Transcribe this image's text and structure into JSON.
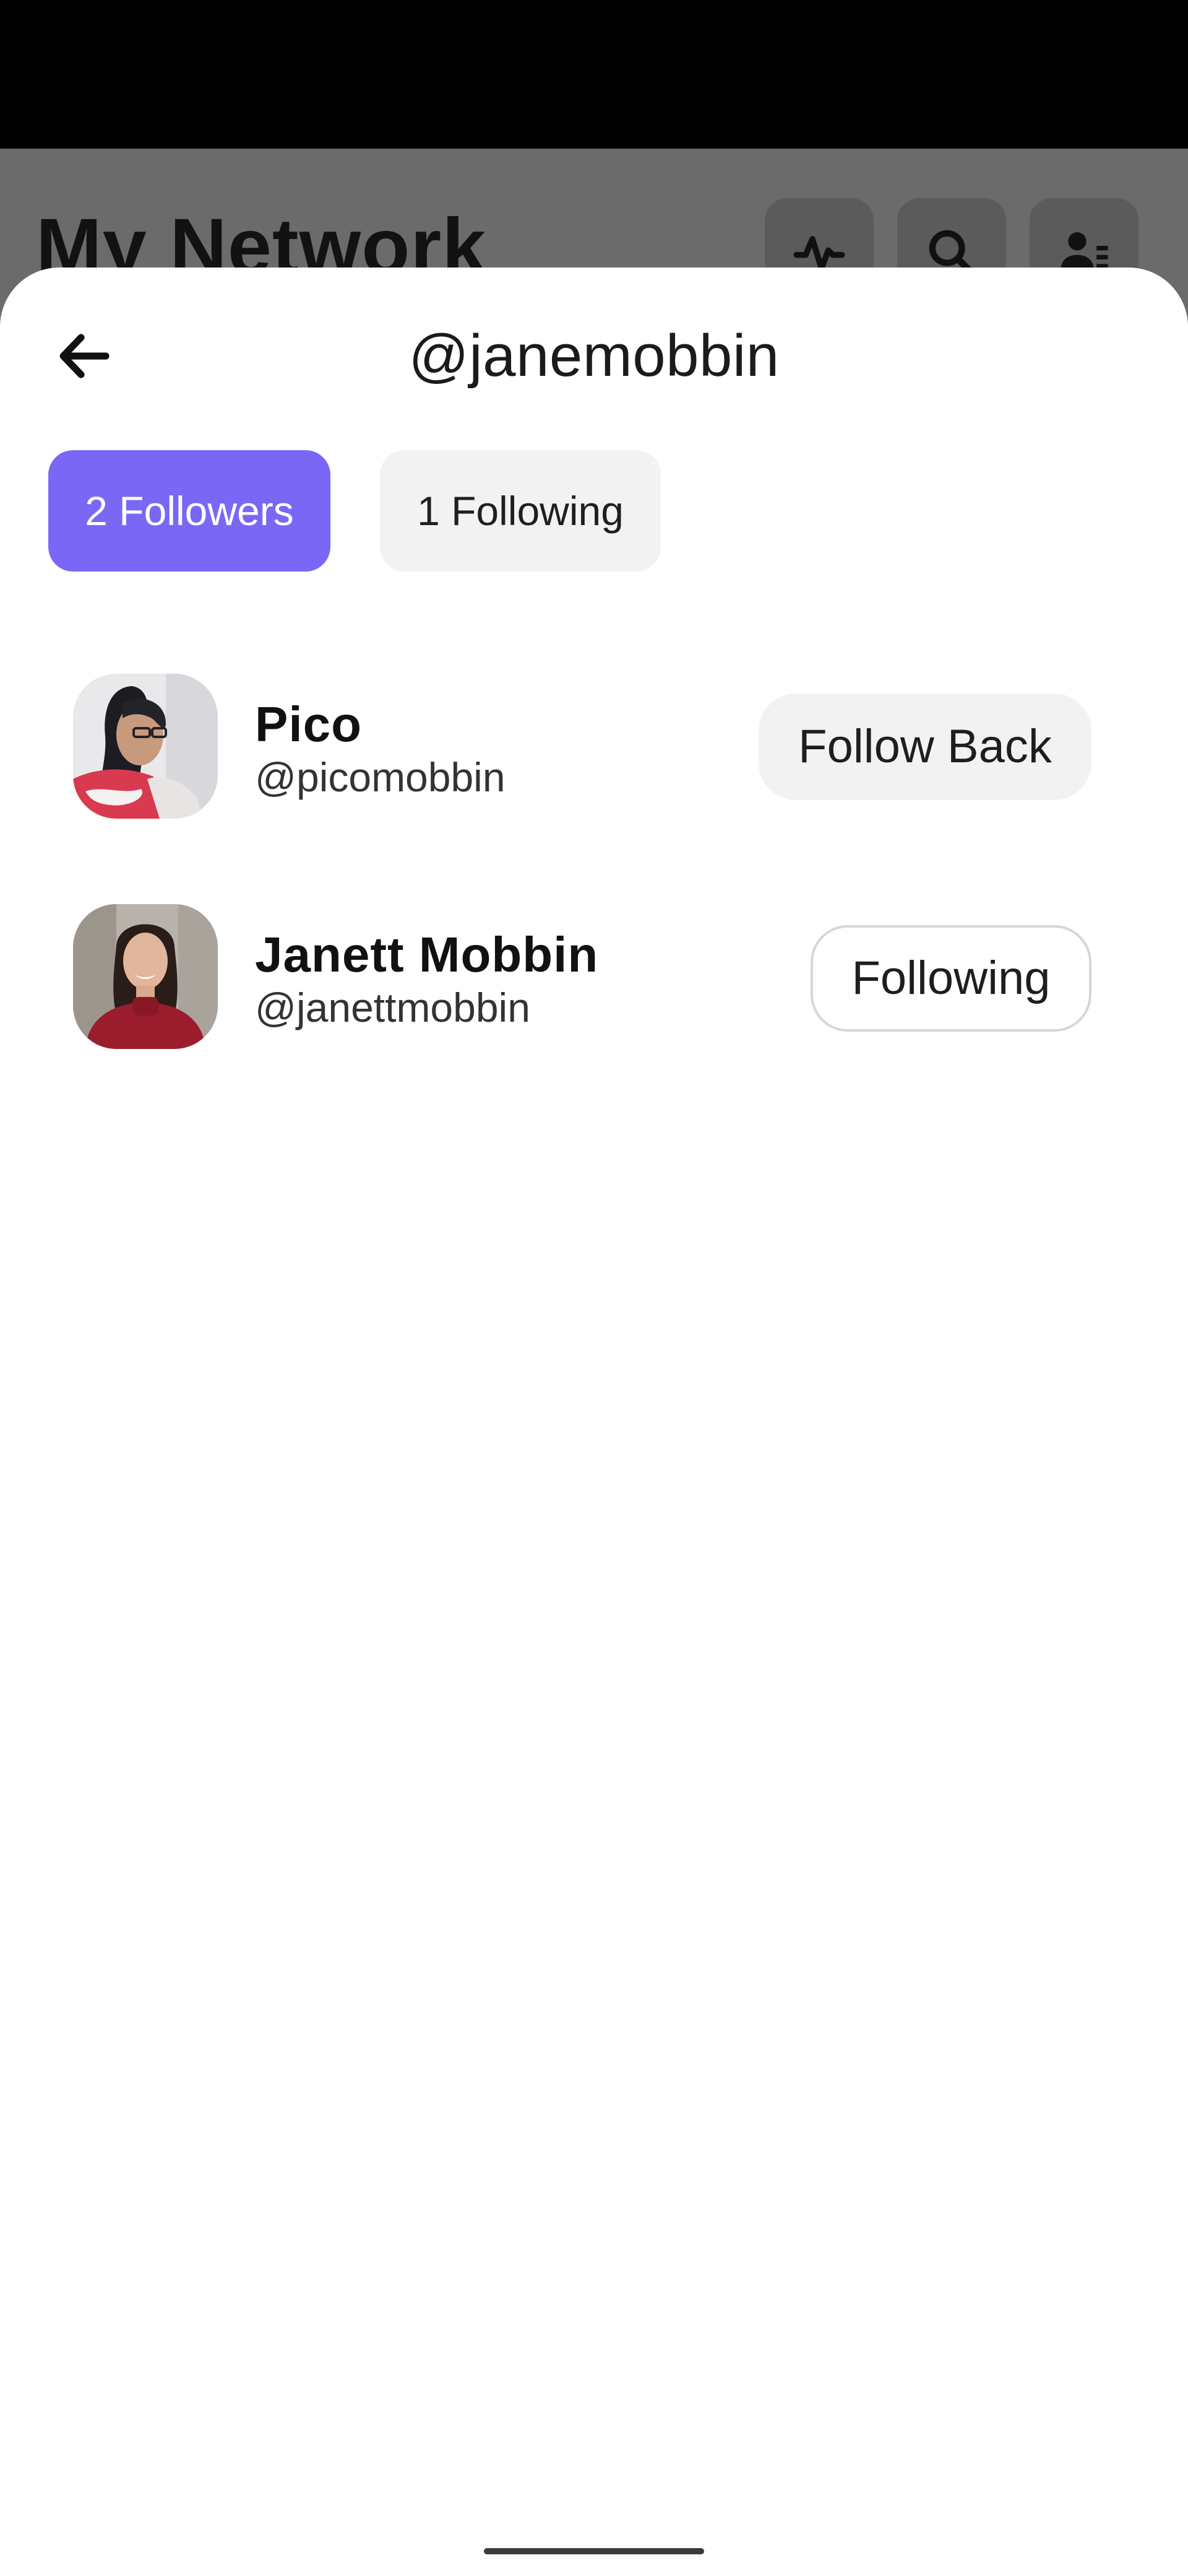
{
  "background": {
    "title": "My Network",
    "icons": [
      "activity-icon",
      "search-icon",
      "people-icon"
    ]
  },
  "sheet": {
    "title": "@janemobbin",
    "back_icon": "arrow-left-icon",
    "tabs": [
      {
        "label": "2 Followers",
        "active": true
      },
      {
        "label": "1 Following",
        "active": false
      }
    ],
    "list": [
      {
        "name": "Pico",
        "handle": "@picomobbin",
        "action": "Follow Back"
      },
      {
        "name": "Janett Mobbin",
        "handle": "@janettmobbin",
        "action": "Following"
      }
    ]
  },
  "colors": {
    "accent": "#7b67f5",
    "chip_bg": "#f2f2f2",
    "overlay": "#6b6b6b"
  }
}
